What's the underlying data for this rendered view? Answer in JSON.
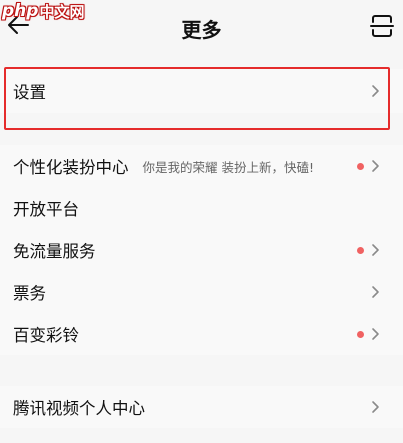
{
  "header": {
    "title": "更多",
    "back_icon": "arrow-left-icon",
    "scan_icon": "scan-icon"
  },
  "watermark": {
    "brand": "php",
    "text": "中文网"
  },
  "settings_group": {
    "items": [
      {
        "label": "设置",
        "has_dot": false
      }
    ]
  },
  "features_group": {
    "items": [
      {
        "label": "个性化装扮中心",
        "hint": "你是我的荣耀 装扮上新，快磕!",
        "has_dot": true
      },
      {
        "label": "开放平台",
        "hint": "",
        "has_dot": false
      },
      {
        "label": "免流量服务",
        "hint": "",
        "has_dot": true
      },
      {
        "label": "票务",
        "hint": "",
        "has_dot": false
      },
      {
        "label": "百变彩铃",
        "hint": "",
        "has_dot": true
      }
    ]
  },
  "personal_group": {
    "items": [
      {
        "label": "腾讯视频个人中心",
        "has_dot": false
      }
    ]
  },
  "colors": {
    "badge_dot": "#f06262",
    "highlight_border": "#e52c2c",
    "chevron": "#8a8a8a"
  }
}
